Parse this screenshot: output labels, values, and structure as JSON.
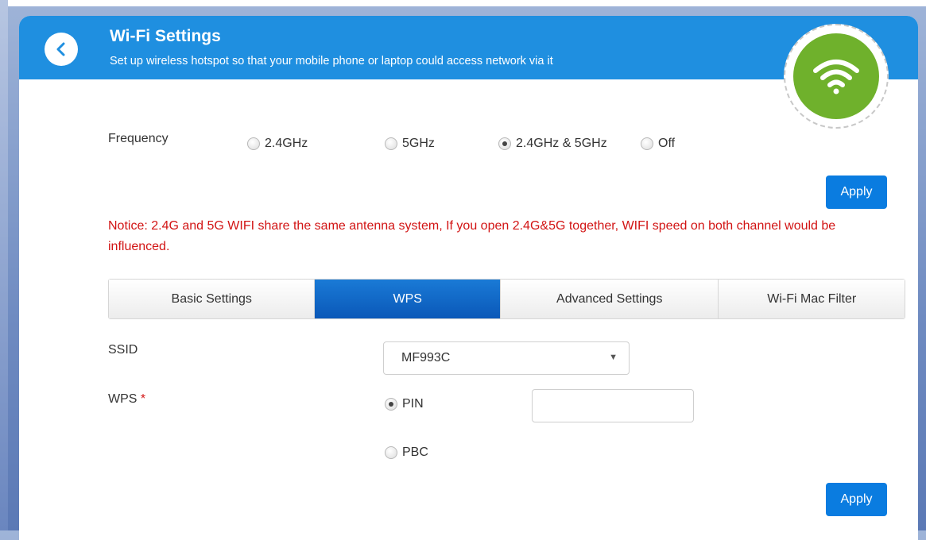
{
  "header": {
    "title": "Wi-Fi Settings",
    "subtitle": "Set up wireless hotspot so that your mobile phone or laptop could access network via it"
  },
  "frequency": {
    "label": "Frequency",
    "options": [
      "2.4GHz",
      "5GHz",
      "2.4GHz & 5GHz",
      "Off"
    ],
    "selected": "2.4GHz & 5GHz",
    "apply_label": "Apply"
  },
  "notice": "Notice: 2.4G and 5G WIFI share the same antenna system, If you open 2.4G&5G together, WIFI speed on both channel would be influenced.",
  "tabs": [
    "Basic Settings",
    "WPS",
    "Advanced Settings",
    "Wi-Fi Mac Filter"
  ],
  "active_tab": "WPS",
  "wps": {
    "ssid_label": "SSID",
    "ssid_value": "MF993C",
    "wps_label": "WPS",
    "required_mark": "*",
    "options": [
      "PIN",
      "PBC"
    ],
    "selected": "PIN",
    "pin_value": "",
    "apply_label": "Apply"
  },
  "colors": {
    "header": "#1f8fe0",
    "wifi_badge": "#6fb12c",
    "accent": "#0a7ce0",
    "notice": "#d21414"
  },
  "icons": {
    "back": "chevron-left-icon",
    "wifi": "wifi-icon",
    "dropdown": "caret-down-icon"
  }
}
